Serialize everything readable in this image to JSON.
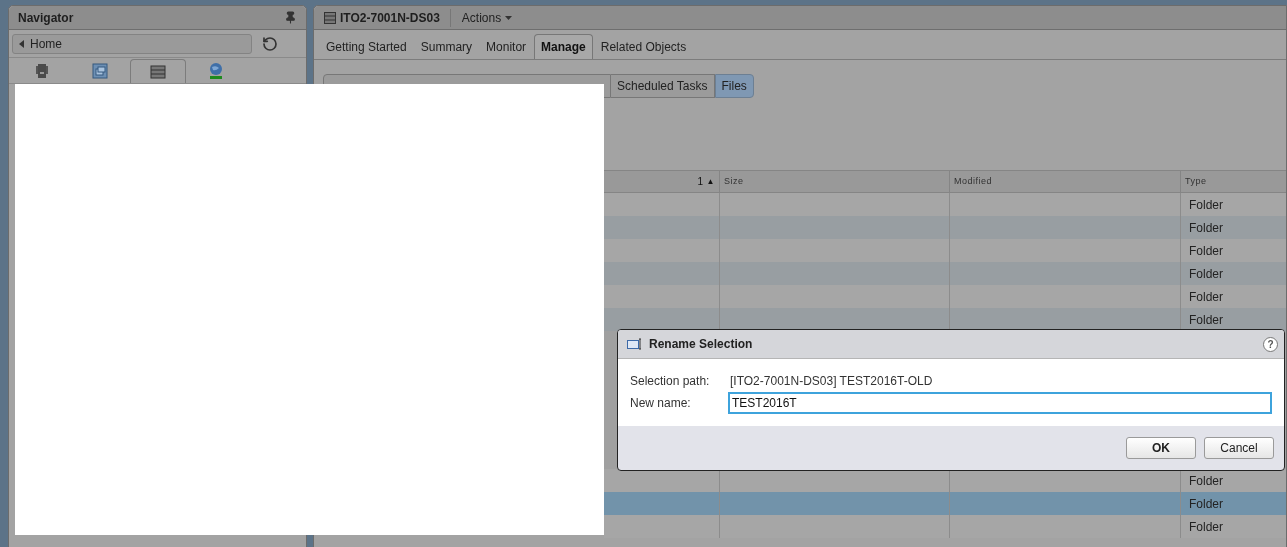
{
  "navigator": {
    "title": "Navigator",
    "breadcrumb": "Home",
    "tabs": [
      {
        "kind": "hosts",
        "selected": false
      },
      {
        "kind": "vms",
        "selected": false
      },
      {
        "kind": "storage",
        "selected": true
      },
      {
        "kind": "network",
        "selected": false
      }
    ]
  },
  "main": {
    "title": "ITO2-7001N-DS03",
    "actions": "Actions",
    "tabs": [
      {
        "label": "Getting Started",
        "selected": false
      },
      {
        "label": "Summary",
        "selected": false
      },
      {
        "label": "Monitor",
        "selected": false
      },
      {
        "label": "Manage",
        "selected": true
      },
      {
        "label": "Related Objects",
        "selected": false
      }
    ],
    "subtabs": [
      {
        "label": "Scheduled Tasks",
        "selected": false
      },
      {
        "label": "Files",
        "selected": true
      }
    ],
    "table": {
      "columns": [
        {
          "label": "1",
          "sort_mark": "▲"
        },
        {
          "label": "Size"
        },
        {
          "label": "Modified"
        },
        {
          "label": "Type"
        }
      ],
      "rows": [
        {
          "type": "Folder",
          "selected": false
        },
        {
          "type": "Folder",
          "selected": false
        },
        {
          "type": "Folder",
          "selected": false
        },
        {
          "type": "Folder",
          "selected": false
        },
        {
          "type": "Folder",
          "selected": false
        },
        {
          "type": "Folder",
          "selected": false
        }
      ],
      "rows_below_dialog": [
        {
          "type": "Folder",
          "selected": false
        },
        {
          "type": "Folder",
          "selected": true
        },
        {
          "type": "Folder",
          "selected": false
        }
      ]
    }
  },
  "dialog": {
    "title": "Rename Selection",
    "help": "?",
    "selection_path": {
      "label": "Selection path:",
      "value": "[ITO2-7001N-DS03] TEST2016T-OLD"
    },
    "new_name": {
      "label": "New name:",
      "value": "TEST2016T"
    },
    "buttons": [
      {
        "label": "OK",
        "kind": "primary"
      },
      {
        "label": "Cancel",
        "kind": "secondary"
      }
    ]
  }
}
